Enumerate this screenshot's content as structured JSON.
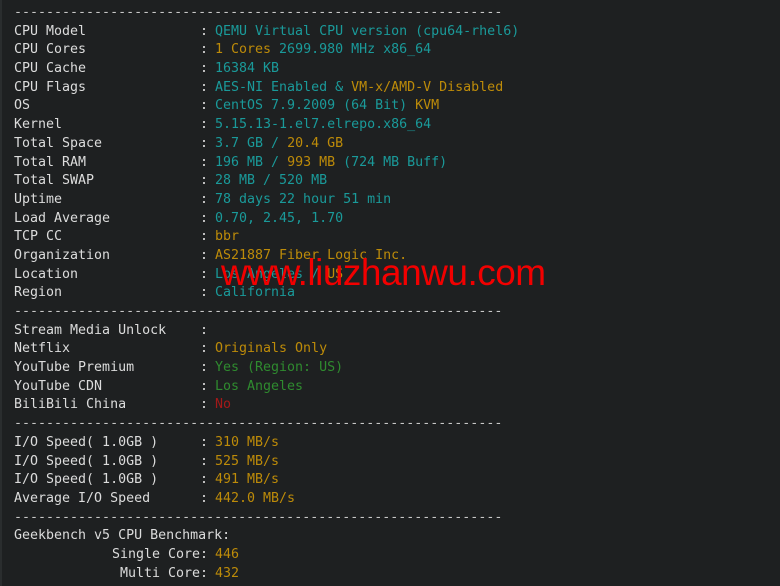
{
  "terminal": {
    "background_color": "#1e2021",
    "default_text_color": "#dcdcdc",
    "accent_colors": {
      "teal": "#1a9a9a",
      "yellow": "#bd8b09",
      "green": "#2f8b2f",
      "red": "#a31919",
      "separator": "#c8c8c8"
    },
    "separator": "-------------------------------------------------------------"
  },
  "watermark": {
    "text": "www.liuzhanwu.com",
    "color": "#f20000"
  },
  "sections": {
    "system": {
      "rows": [
        {
          "label": "CPU Model",
          "segments": [
            {
              "text": "QEMU Virtual CPU version (cpu64-rhel6)",
              "color": "teal"
            }
          ]
        },
        {
          "label": "CPU Cores",
          "segments": [
            {
              "text": "1 Cores",
              "color": "yellow"
            },
            {
              "text": " 2699.980 MHz x86_64",
              "color": "teal"
            }
          ]
        },
        {
          "label": "CPU Cache",
          "segments": [
            {
              "text": "16384 KB",
              "color": "teal"
            }
          ]
        },
        {
          "label": "CPU Flags",
          "segments": [
            {
              "text": "AES-NI Enabled & ",
              "color": "teal"
            },
            {
              "text": "VM-x/AMD-V Disabled",
              "color": "yellow"
            }
          ]
        },
        {
          "label": "OS",
          "segments": [
            {
              "text": "CentOS 7.9.2009 (64 Bit) ",
              "color": "teal"
            },
            {
              "text": "KVM",
              "color": "yellow"
            }
          ]
        },
        {
          "label": "Kernel",
          "segments": [
            {
              "text": "5.15.13-1.el7.elrepo.x86_64",
              "color": "teal"
            }
          ]
        },
        {
          "label": "Total Space",
          "segments": [
            {
              "text": "3.7 GB / ",
              "color": "teal"
            },
            {
              "text": "20.4 GB",
              "color": "yellow"
            }
          ]
        },
        {
          "label": "Total RAM",
          "segments": [
            {
              "text": "196 MB / ",
              "color": "teal"
            },
            {
              "text": "993 MB",
              "color": "yellow"
            },
            {
              "text": " (724 MB Buff)",
              "color": "teal"
            }
          ]
        },
        {
          "label": "Total SWAP",
          "segments": [
            {
              "text": "28 MB / 520 MB",
              "color": "teal"
            }
          ]
        },
        {
          "label": "Uptime",
          "segments": [
            {
              "text": "78 days 22 hour 51 min",
              "color": "teal"
            }
          ]
        },
        {
          "label": "Load Average",
          "segments": [
            {
              "text": "0.70, 2.45, 1.70",
              "color": "teal"
            }
          ]
        },
        {
          "label": "TCP CC",
          "segments": [
            {
              "text": "bbr",
              "color": "yellow"
            }
          ]
        },
        {
          "label": "Organization",
          "segments": [
            {
              "text": "AS21887 Fiber Logic Inc.",
              "color": "yellow"
            }
          ]
        },
        {
          "label": "Location",
          "segments": [
            {
              "text": "Los Angeles / ",
              "color": "teal"
            },
            {
              "text": "US",
              "color": "yellow"
            }
          ]
        },
        {
          "label": "Region",
          "segments": [
            {
              "text": "California",
              "color": "teal"
            }
          ]
        }
      ]
    },
    "stream_media": {
      "rows": [
        {
          "label": "Stream Media Unlock",
          "segments": []
        },
        {
          "label": "Netflix",
          "segments": [
            {
              "text": "Originals Only",
              "color": "yellow"
            }
          ]
        },
        {
          "label": "YouTube Premium",
          "segments": [
            {
              "text": "Yes (Region: US)",
              "color": "green"
            }
          ]
        },
        {
          "label": "YouTube CDN",
          "segments": [
            {
              "text": "Los Angeles",
              "color": "green"
            }
          ]
        },
        {
          "label": "BiliBili China",
          "segments": [
            {
              "text": "No",
              "color": "red"
            }
          ]
        }
      ]
    },
    "io_speed": {
      "rows": [
        {
          "label": "I/O Speed( 1.0GB )",
          "segments": [
            {
              "text": "310 MB/s",
              "color": "yellow"
            }
          ]
        },
        {
          "label": "I/O Speed( 1.0GB )",
          "segments": [
            {
              "text": "525 MB/s",
              "color": "yellow"
            }
          ]
        },
        {
          "label": "I/O Speed( 1.0GB )",
          "segments": [
            {
              "text": "491 MB/s",
              "color": "yellow"
            }
          ]
        },
        {
          "label": "Average I/O Speed",
          "segments": [
            {
              "text": "442.0 MB/s",
              "color": "yellow"
            }
          ]
        }
      ]
    },
    "geekbench": {
      "heading": "Geekbench v5 CPU Benchmark:",
      "rows": [
        {
          "label": "Single Core",
          "indent": true,
          "segments": [
            {
              "text": "446",
              "color": "yellow"
            }
          ]
        },
        {
          "label": "Multi Core",
          "indent": true,
          "segments": [
            {
              "text": "432",
              "color": "yellow"
            }
          ]
        }
      ]
    }
  }
}
